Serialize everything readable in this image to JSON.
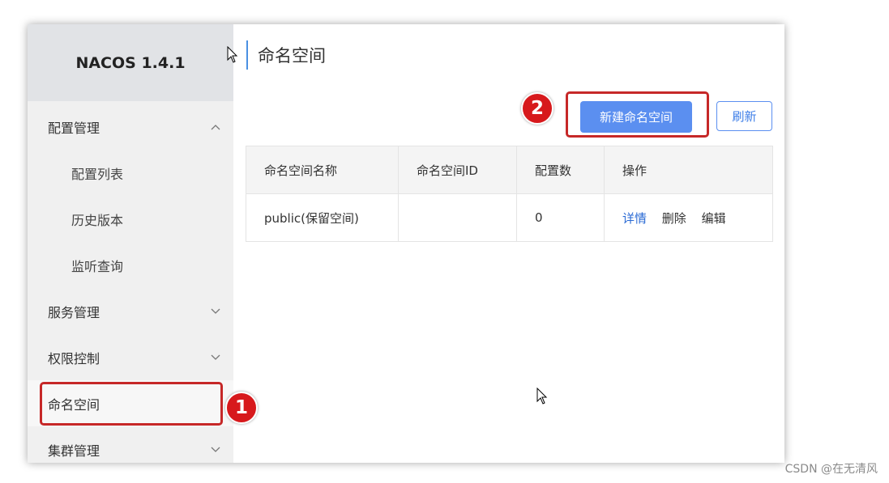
{
  "app": {
    "brand": "NACOS 1.4.1"
  },
  "sidebar": {
    "items": [
      {
        "label": "配置管理",
        "expanded": true
      },
      {
        "label": "配置列表"
      },
      {
        "label": "历史版本"
      },
      {
        "label": "监听查询"
      },
      {
        "label": "服务管理",
        "expanded": false
      },
      {
        "label": "权限控制",
        "expanded": false
      },
      {
        "label": "命名空间",
        "active": true
      },
      {
        "label": "集群管理",
        "expanded": false
      }
    ]
  },
  "main": {
    "title": "命名空间",
    "create_button": "新建命名空间",
    "refresh_button": "刷新",
    "table": {
      "columns": [
        "命名空间名称",
        "命名空间ID",
        "配置数",
        "操作"
      ],
      "rows": [
        {
          "name": "public(保留空间)",
          "id": "",
          "count": "0",
          "ops": [
            "详情",
            "删除",
            "编辑"
          ]
        }
      ]
    }
  },
  "annotations": {
    "badge_1": "1",
    "badge_2": "2"
  },
  "watermark": "CSDN @在无清风",
  "colors": {
    "primary": "#5b8ff0",
    "annotation_red": "#c62828",
    "badge_red": "#d7191c",
    "link": "#2a6ad4"
  }
}
